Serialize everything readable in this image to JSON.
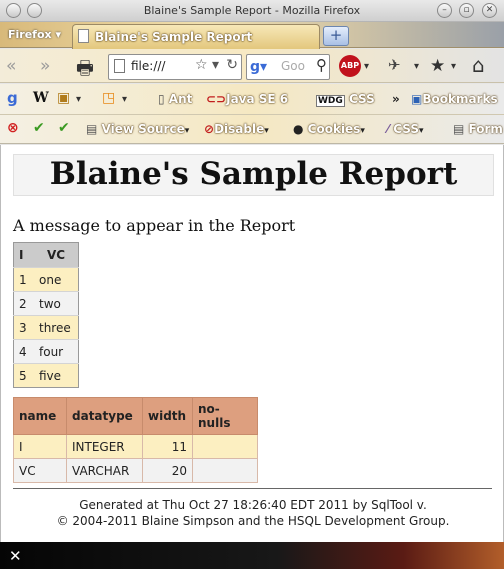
{
  "window": {
    "title": "Blaine's Sample Report - Mozilla Firefox"
  },
  "tabbar": {
    "firefox_button": "Firefox",
    "tab_title": "Blaine's Sample Report",
    "new_tab": "+"
  },
  "navbar": {
    "url": "file:///",
    "search_placeholder": "Goo",
    "abp": "ABP"
  },
  "bookmarks": {
    "items": [
      "Ant",
      "Java SE 6",
      "CSS"
    ],
    "wdg_label": "WDG",
    "overflow": "»",
    "bookmarks_menu": "Bookmarks"
  },
  "webdev": {
    "view_source": "View Source",
    "disable": "Disable",
    "cookies": "Cookies",
    "css": "CSS",
    "forms": "Form"
  },
  "report": {
    "title": "Blaine's Sample Report",
    "message": "A message to appear in the Report",
    "table1": {
      "headers": [
        "I",
        "VC"
      ],
      "rows": [
        [
          "1",
          "one"
        ],
        [
          "2",
          "two"
        ],
        [
          "3",
          "three"
        ],
        [
          "4",
          "four"
        ],
        [
          "5",
          "five"
        ]
      ]
    },
    "table2": {
      "headers": [
        "name",
        "datatype",
        "width",
        "no-nulls"
      ],
      "rows": [
        [
          "I",
          "INTEGER",
          "11",
          ""
        ],
        [
          "VC",
          "VARCHAR",
          "20",
          ""
        ]
      ]
    },
    "footer_line1": "Generated at Thu Oct 27 18:26:40 EDT 2011 by SqlTool v.",
    "footer_line2": "© 2004-2011 Blaine Simpson and the HSQL Development Group."
  },
  "findbar": {
    "close": "✕"
  }
}
